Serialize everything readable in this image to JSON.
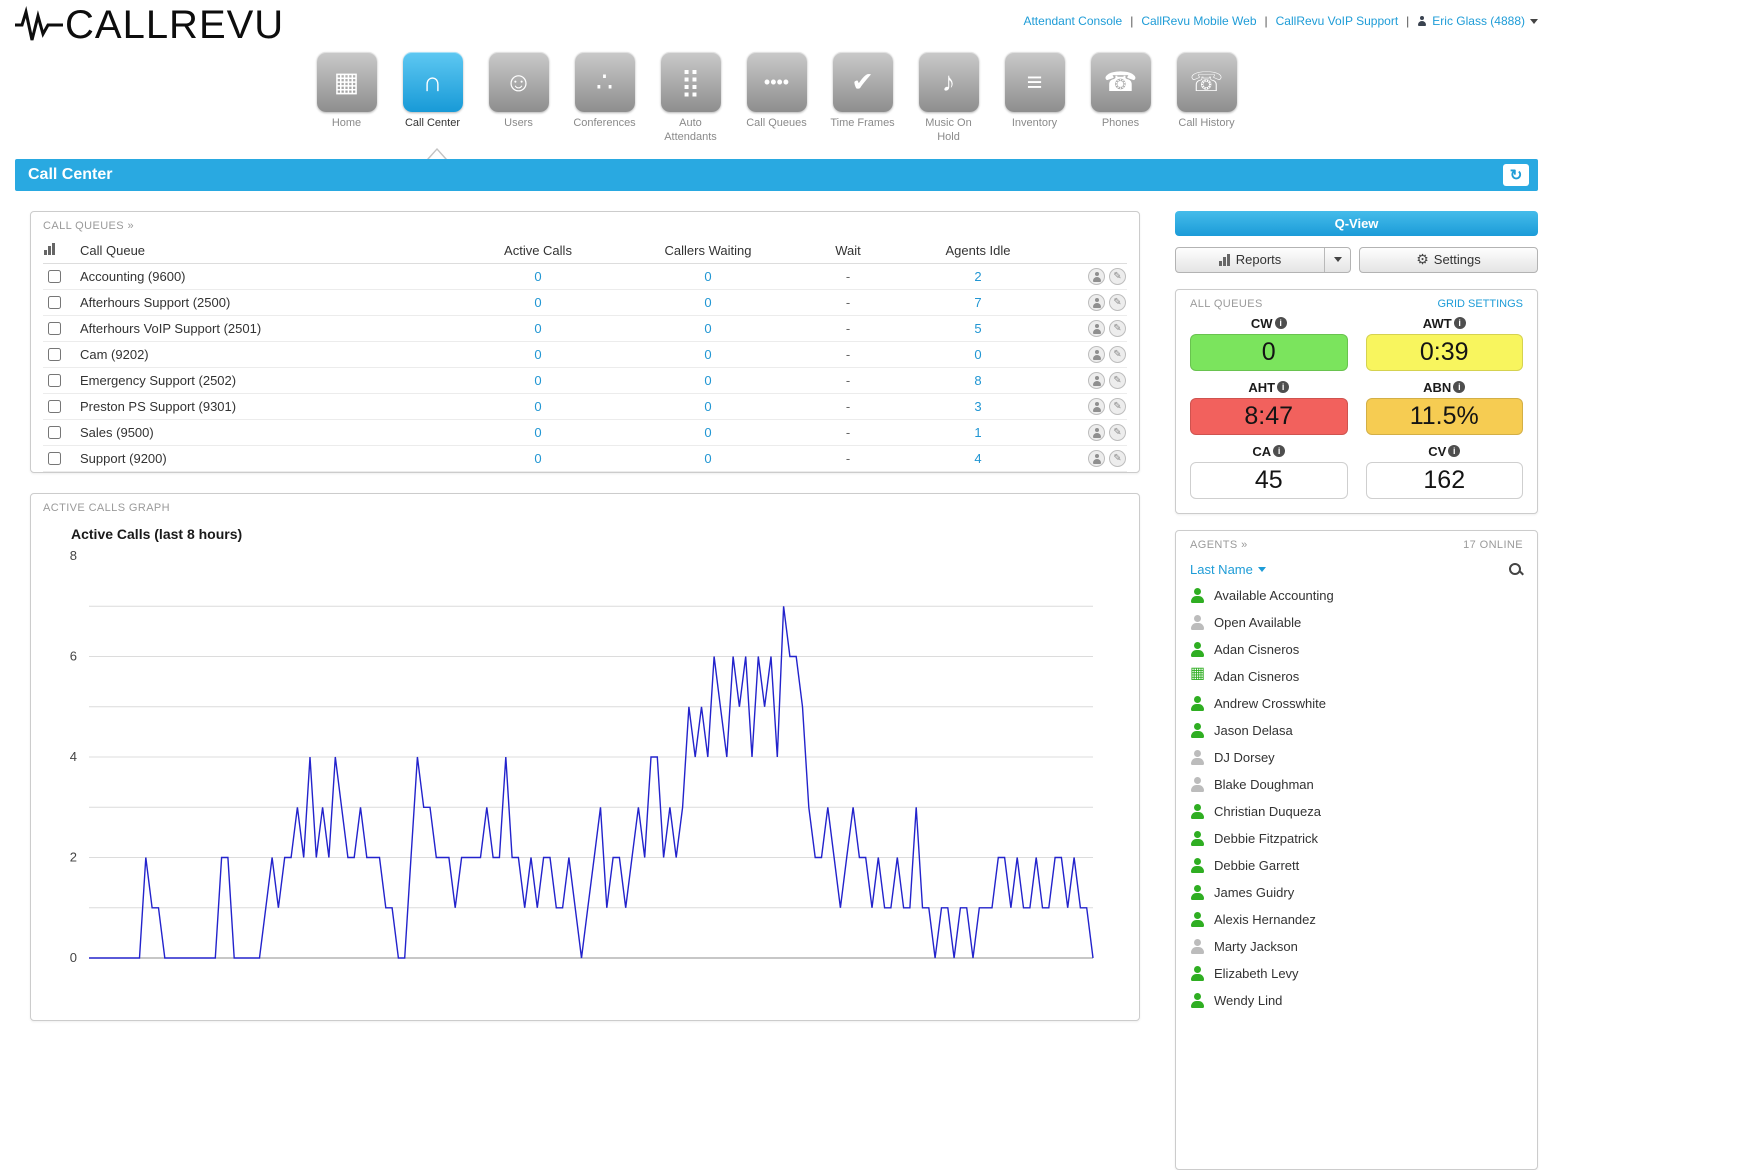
{
  "accent": {
    "blue": "#29a9e1",
    "link_blue": "#1e9cd7",
    "chart_line": "#2323cc"
  },
  "icons": {
    "pencil": "✎",
    "gear": "⚙",
    "refresh": "↻"
  },
  "header": {
    "logo_text": "CALLREVU",
    "separator": "|",
    "links": [
      {
        "label": "Attendant Console"
      },
      {
        "label": "CallRevu Mobile Web"
      },
      {
        "label": "CallRevu VoIP Support"
      }
    ],
    "user": {
      "name": "Eric Glass (4888)"
    }
  },
  "nav": {
    "items": [
      {
        "name": "home",
        "label": "Home",
        "glyph": "▦"
      },
      {
        "name": "call-center",
        "label": "Call Center",
        "glyph": "∩"
      },
      {
        "name": "users",
        "label": "Users",
        "glyph": "☺"
      },
      {
        "name": "conferences",
        "label": "Conferences",
        "glyph": "∴"
      },
      {
        "name": "auto-attendants",
        "label": "Auto Attendants",
        "glyph": "⣿"
      },
      {
        "name": "call-queues",
        "label": "Call Queues",
        "glyph": "••••"
      },
      {
        "name": "time-frames",
        "label": "Time Frames",
        "glyph": "✔"
      },
      {
        "name": "music-on-hold",
        "label": "Music On Hold",
        "glyph": "♪"
      },
      {
        "name": "inventory",
        "label": "Inventory",
        "glyph": "≡"
      },
      {
        "name": "phones",
        "label": "Phones",
        "glyph": "☎"
      },
      {
        "name": "call-history",
        "label": "Call History",
        "glyph": "☏"
      }
    ]
  },
  "title_bar": {
    "title": "Call Center"
  },
  "call_queues": {
    "panel_title": "CALL QUEUES »",
    "columns": {
      "name": "Call Queue",
      "active": "Active Calls",
      "waiting": "Callers Waiting",
      "wait": "Wait",
      "idle": "Agents Idle"
    },
    "rows": [
      {
        "name": "Accounting (9600)",
        "active": "0",
        "waiting": "0",
        "wait": "-",
        "idle": "2"
      },
      {
        "name": "Afterhours Support (2500)",
        "active": "0",
        "waiting": "0",
        "wait": "-",
        "idle": "7"
      },
      {
        "name": "Afterhours VoIP Support (2501)",
        "active": "0",
        "waiting": "0",
        "wait": "-",
        "idle": "5"
      },
      {
        "name": "Cam (9202)",
        "active": "0",
        "waiting": "0",
        "wait": "-",
        "idle": "0"
      },
      {
        "name": "Emergency Support (2502)",
        "active": "0",
        "waiting": "0",
        "wait": "-",
        "idle": "8"
      },
      {
        "name": "Preston PS Support (9301)",
        "active": "0",
        "waiting": "0",
        "wait": "-",
        "idle": "3"
      },
      {
        "name": "Sales (9500)",
        "active": "0",
        "waiting": "0",
        "wait": "-",
        "idle": "1"
      },
      {
        "name": "Support (9200)",
        "active": "0",
        "waiting": "0",
        "wait": "-",
        "idle": "4"
      }
    ]
  },
  "graph_panel": {
    "panel_title": "ACTIVE CALLS GRAPH"
  },
  "chart_data": {
    "type": "line",
    "title": "Active Calls (last 8 hours)",
    "xlabel": "",
    "ylabel": "",
    "x_span_hours": 8,
    "ylim": [
      0,
      8
    ],
    "yticks": [
      0,
      2,
      4,
      6,
      8
    ],
    "grid": true,
    "legend": false,
    "line_color": "#2323cc",
    "values": [
      0,
      0,
      0,
      0,
      0,
      0,
      0,
      0,
      0,
      2,
      1,
      1,
      0,
      0,
      0,
      0,
      0,
      0,
      0,
      0,
      0,
      2,
      2,
      0,
      0,
      0,
      0,
      0,
      1,
      2,
      1,
      2,
      2,
      3,
      2,
      4,
      2,
      3,
      2,
      4,
      3,
      2,
      2,
      3,
      2,
      2,
      2,
      1,
      1,
      0,
      0,
      2,
      4,
      3,
      3,
      2,
      2,
      2,
      1,
      2,
      2,
      2,
      2,
      3,
      2,
      2,
      4,
      2,
      2,
      1,
      2,
      1,
      2,
      2,
      1,
      1,
      2,
      1,
      0,
      1,
      2,
      3,
      1,
      2,
      2,
      1,
      2,
      3,
      2,
      4,
      4,
      2,
      3,
      2,
      3,
      5,
      4,
      5,
      4,
      6,
      5,
      4,
      6,
      5,
      6,
      4,
      6,
      5,
      6,
      4,
      7,
      6,
      6,
      5,
      3,
      2,
      2,
      3,
      2,
      1,
      2,
      3,
      2,
      2,
      1,
      2,
      1,
      1,
      2,
      1,
      1,
      3,
      1,
      1,
      0,
      1,
      1,
      0,
      1,
      1,
      0,
      1,
      1,
      1,
      2,
      2,
      1,
      2,
      1,
      1,
      2,
      1,
      1,
      2,
      2,
      1,
      2,
      1,
      1,
      0
    ]
  },
  "sidebar": {
    "qview_label": "Q-View",
    "reports_label": "Reports",
    "settings_label": "Settings",
    "all_queues": {
      "title": "ALL QUEUES",
      "grid_settings_label": "GRID SETTINGS",
      "stats": [
        {
          "label": "CW",
          "value": "0",
          "bg": "#7be45d"
        },
        {
          "label": "AWT",
          "value": "0:39",
          "bg": "#f8f55e"
        },
        {
          "label": "AHT",
          "value": "8:47",
          "bg": "#f2615d"
        },
        {
          "label": "ABN",
          "value": "11.5%",
          "bg": "#f6cc52"
        },
        {
          "label": "CA",
          "value": "45",
          "bg": "#ffffff"
        },
        {
          "label": "CV",
          "value": "162",
          "bg": "#ffffff"
        }
      ]
    },
    "agents": {
      "title": "AGENTS »",
      "online_label": "17 ONLINE",
      "sort_label": "Last Name",
      "items": [
        {
          "name": "Available Accounting",
          "status": "available"
        },
        {
          "name": "Open Available",
          "status": "offline"
        },
        {
          "name": "Adan Cisneros",
          "status": "available"
        },
        {
          "name": "Adan Cisneros",
          "status": "on-phone"
        },
        {
          "name": "Andrew Crosswhite",
          "status": "available"
        },
        {
          "name": "Jason Delasa",
          "status": "available"
        },
        {
          "name": "DJ Dorsey",
          "status": "offline"
        },
        {
          "name": "Blake Doughman",
          "status": "offline"
        },
        {
          "name": "Christian Duqueza",
          "status": "available"
        },
        {
          "name": "Debbie Fitzpatrick",
          "status": "available"
        },
        {
          "name": "Debbie Garrett",
          "status": "available"
        },
        {
          "name": "James Guidry",
          "status": "available"
        },
        {
          "name": "Alexis Hernandez",
          "status": "available"
        },
        {
          "name": "Marty Jackson",
          "status": "offline"
        },
        {
          "name": "Elizabeth Levy",
          "status": "available"
        },
        {
          "name": "Wendy Lind",
          "status": "available"
        }
      ]
    }
  }
}
